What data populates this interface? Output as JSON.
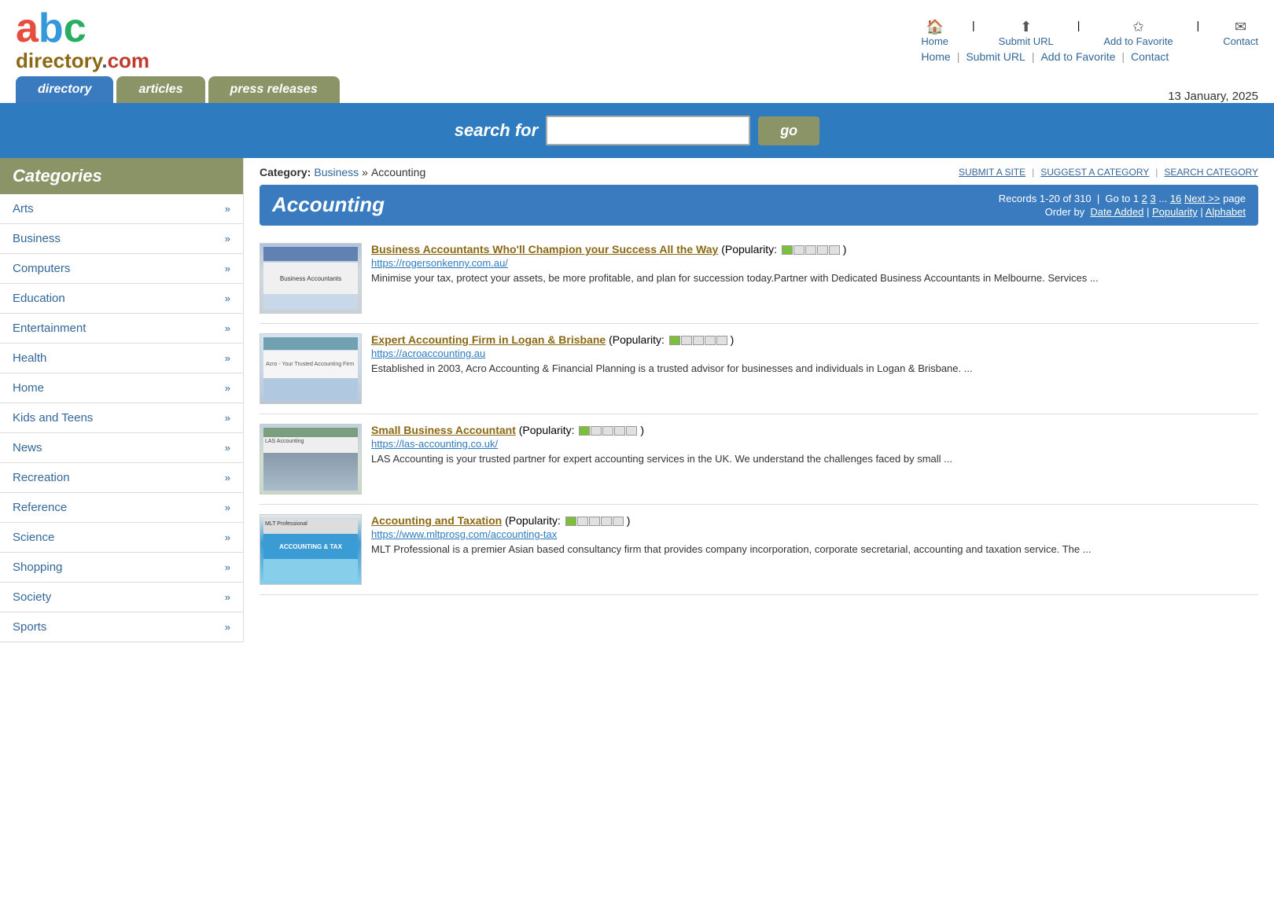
{
  "logo": {
    "abc": [
      "a",
      "b",
      "c"
    ],
    "suffix": "directory",
    "dot": ".",
    "com": "com"
  },
  "header": {
    "nav_icons": [
      {
        "label": "Home",
        "icon": "🏠"
      },
      {
        "label": "Submit URL",
        "icon": "⬆"
      },
      {
        "label": "Add to Favorite",
        "icon": "✩"
      },
      {
        "label": "Contact",
        "icon": "✉"
      }
    ],
    "date": "13 January, 2025"
  },
  "tabs": [
    {
      "label": "directory",
      "active": true
    },
    {
      "label": "articles",
      "active": false
    },
    {
      "label": "press releases",
      "active": false
    }
  ],
  "search": {
    "label": "search for",
    "placeholder": "",
    "button": "go"
  },
  "sidebar": {
    "header": "Categories",
    "items": [
      {
        "label": "Arts",
        "arrow": "»"
      },
      {
        "label": "Business",
        "arrow": "»"
      },
      {
        "label": "Computers",
        "arrow": "»"
      },
      {
        "label": "Education",
        "arrow": "»"
      },
      {
        "label": "Entertainment",
        "arrow": "»"
      },
      {
        "label": "Health",
        "arrow": "»"
      },
      {
        "label": "Home",
        "arrow": "»"
      },
      {
        "label": "Kids and Teens",
        "arrow": "»"
      },
      {
        "label": "News",
        "arrow": "»"
      },
      {
        "label": "Recreation",
        "arrow": "»"
      },
      {
        "label": "Reference",
        "arrow": "»"
      },
      {
        "label": "Science",
        "arrow": "»"
      },
      {
        "label": "Shopping",
        "arrow": "»"
      },
      {
        "label": "Society",
        "arrow": "»"
      },
      {
        "label": "Sports",
        "arrow": "»"
      }
    ]
  },
  "breadcrumb": {
    "category_label": "Category:",
    "parent": "Business",
    "separator": "»",
    "current": "Accounting",
    "actions": [
      {
        "label": "SUBMIT A SITE"
      },
      {
        "label": "SUGGEST A CATEGORY"
      },
      {
        "label": "SEARCH CATEGORY"
      }
    ]
  },
  "category": {
    "title": "Accounting",
    "records_prefix": "Records 1-20 of 310",
    "pipe": "|",
    "goto_label": "Go to 1",
    "pages": [
      "2",
      "3",
      "...",
      "16"
    ],
    "next": "Next >>",
    "page_suffix": "page",
    "order_label": "Order by",
    "order_options": [
      "Date Added",
      "Popularity",
      "Alphabet"
    ]
  },
  "listings": [
    {
      "title": "Business Accountants Who'll Champion your Success All the Way",
      "popularity_filled": 1,
      "popularity_total": 5,
      "url": "https://rogersonkenny.com.au/",
      "desc": "Minimise your tax, protect your assets, be more profitable, and plan for succession today.Partner with Dedicated Business Accountants in Melbourne. Services ..."
    },
    {
      "title": "Expert Accounting Firm in Logan & Brisbane",
      "popularity_filled": 1,
      "popularity_total": 5,
      "url": "https://acroaccounting.au",
      "desc": "Established in 2003, Acro Accounting & Financial Planning is a trusted advisor for businesses and individuals in Logan & Brisbane. ..."
    },
    {
      "title": "Small Business Accountant",
      "popularity_filled": 1,
      "popularity_total": 5,
      "url": "https://las-accounting.co.uk/",
      "desc": "LAS Accounting is your trusted partner for expert accounting services in the UK. We understand the challenges faced by small ..."
    },
    {
      "title": "Accounting and Taxation",
      "popularity_filled": 1,
      "popularity_total": 5,
      "url": "https://www.mltprosg.com/accounting-tax",
      "desc": "MLT Professional is a premier Asian based consultancy firm that provides company incorporation, corporate secretarial, accounting and taxation service. The ..."
    }
  ]
}
